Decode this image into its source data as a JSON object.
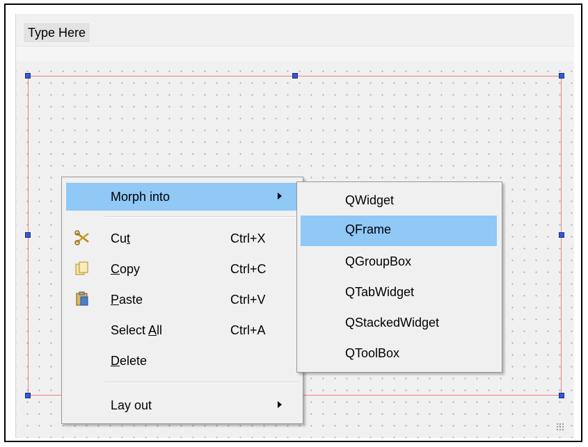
{
  "menubar": {
    "type_here_label": "Type Here"
  },
  "context_menu": {
    "items": [
      {
        "label": "Morph into",
        "shortcut": "",
        "icon": "",
        "has_submenu": true,
        "highlighted": true
      },
      {
        "label": "Cut",
        "mnemonic": "t",
        "shortcut": "Ctrl+X",
        "icon": "scissors-icon"
      },
      {
        "label": "Copy",
        "mnemonic": "C",
        "shortcut": "Ctrl+C",
        "icon": "copy-icon"
      },
      {
        "label": "Paste",
        "mnemonic": "P",
        "shortcut": "Ctrl+V",
        "icon": "paste-icon"
      },
      {
        "label": "Select All",
        "mnemonic": "A",
        "shortcut": "Ctrl+A",
        "icon": ""
      },
      {
        "label": "Delete",
        "mnemonic": "D",
        "shortcut": "",
        "icon": ""
      },
      {
        "label": "Lay out",
        "shortcut": "",
        "icon": "",
        "has_submenu": true
      }
    ]
  },
  "submenu": {
    "items": [
      {
        "label": "QWidget"
      },
      {
        "label": "QFrame",
        "highlighted": true
      },
      {
        "label": "QGroupBox"
      },
      {
        "label": "QTabWidget"
      },
      {
        "label": "QStackedWidget"
      },
      {
        "label": "QToolBox"
      }
    ]
  },
  "colors": {
    "highlight": "#90c8f6",
    "selection_handle": "#2f5bd8",
    "widget_border": "#f08080",
    "menu_background": "#f0f0f0"
  }
}
